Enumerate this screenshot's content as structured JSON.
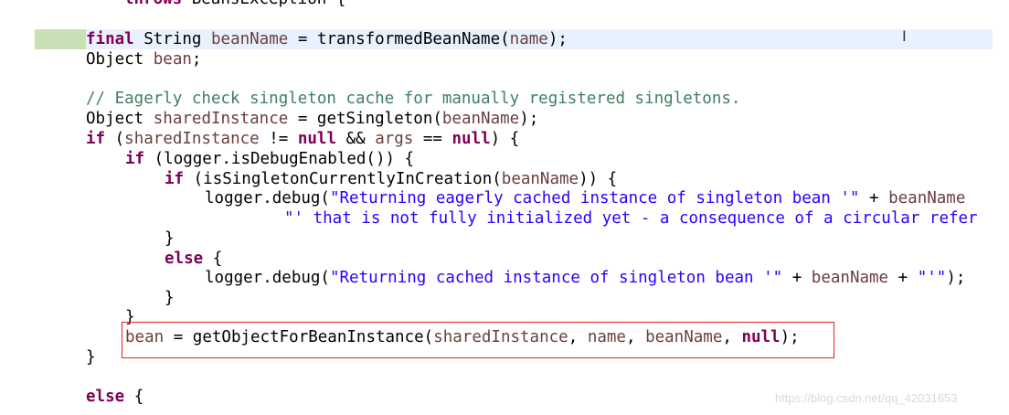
{
  "editor": {
    "language": "java",
    "lines": [
      {
        "id": "l0",
        "text": "throws BeansException {"
      },
      {
        "id": "l1",
        "text": "final String beanName = transformedBeanName(name);"
      },
      {
        "id": "l2",
        "text": "Object bean;"
      },
      {
        "id": "l3",
        "text": "// Eagerly check singleton cache for manually registered singletons."
      },
      {
        "id": "l4",
        "text": "Object sharedInstance = getSingleton(beanName);"
      },
      {
        "id": "l5",
        "text": "if (sharedInstance != null && args == null) {"
      },
      {
        "id": "l6",
        "text": "if (logger.isDebugEnabled()) {"
      },
      {
        "id": "l7",
        "text": "if (isSingletonCurrentlyInCreation(beanName)) {"
      },
      {
        "id": "l8",
        "text": "logger.debug(\"Returning eagerly cached instance of singleton bean '\" + beanName"
      },
      {
        "id": "l9",
        "text": "\"' that is not fully initialized yet - a consequence of a circular refer"
      },
      {
        "id": "l10",
        "text": "}"
      },
      {
        "id": "l11",
        "text": "else {"
      },
      {
        "id": "l12",
        "text": "logger.debug(\"Returning cached instance of singleton bean '\" + beanName + \"'\");"
      },
      {
        "id": "l13",
        "text": "}"
      },
      {
        "id": "l14",
        "text": "}"
      },
      {
        "id": "l15",
        "text": "bean = getObjectForBeanInstance(sharedInstance, name, beanName, null);"
      },
      {
        "id": "l16",
        "text": "}"
      },
      {
        "id": "l17",
        "text": "else {"
      }
    ],
    "tokens": {
      "throws": "throws",
      "beansException": "BeansException {",
      "final": "final",
      "string": "String",
      "beanName": "beanName",
      "eq": "=",
      "transformedBeanName": "transformedBeanName(",
      "name": "name",
      "closeParenSemi": ");",
      "object": "Object",
      "bean": "bean",
      "semi": ";",
      "comment": "// Eagerly check singleton cache for manually registered singletons.",
      "sharedInstance": "sharedInstance",
      "getSingleton": "getSingleton(",
      "if": "if",
      "openParen": "(",
      "neqNull": "!=",
      "null": "null",
      "and": "&&",
      "args": "args",
      "eqeq": "==",
      "closeBrace": ") {",
      "loggerIsDebug": "(logger.isDebugEnabled()) {",
      "isSingletonCurrentlyInCreation": "(isSingletonCurrentlyInCreation(",
      "closeParenBrace": ")) {",
      "loggerDebug": "logger.debug(",
      "strEagerly": "\"Returning eagerly cached instance of singleton bean '\"",
      "plus": "+",
      "strNotFully": "\"' that is not fully initialized yet - a consequence of a circular refer",
      "rbrace": "}",
      "else": "else",
      "lbrace": "{",
      "strCached": "\"Returning cached instance of singleton bean '\"",
      "strQuote": "\"'\"",
      "getObjectForBeanInstance": "getObjectForBeanInstance(",
      "comma": ",",
      "closeStmt": ");"
    }
  },
  "cursor": {
    "glyph": "I"
  },
  "watermark": {
    "text": "https://blog.csdn.net/qq_42031653"
  },
  "colors": {
    "keyword": "#7f0055",
    "localVariable": "#6a3e3e",
    "string": "#2a00ff",
    "comment": "#3f7f5f",
    "currentLine": "#e8f2fe",
    "lineMarker": "#c8e0b4",
    "selectionBorder": "#e0251c"
  }
}
